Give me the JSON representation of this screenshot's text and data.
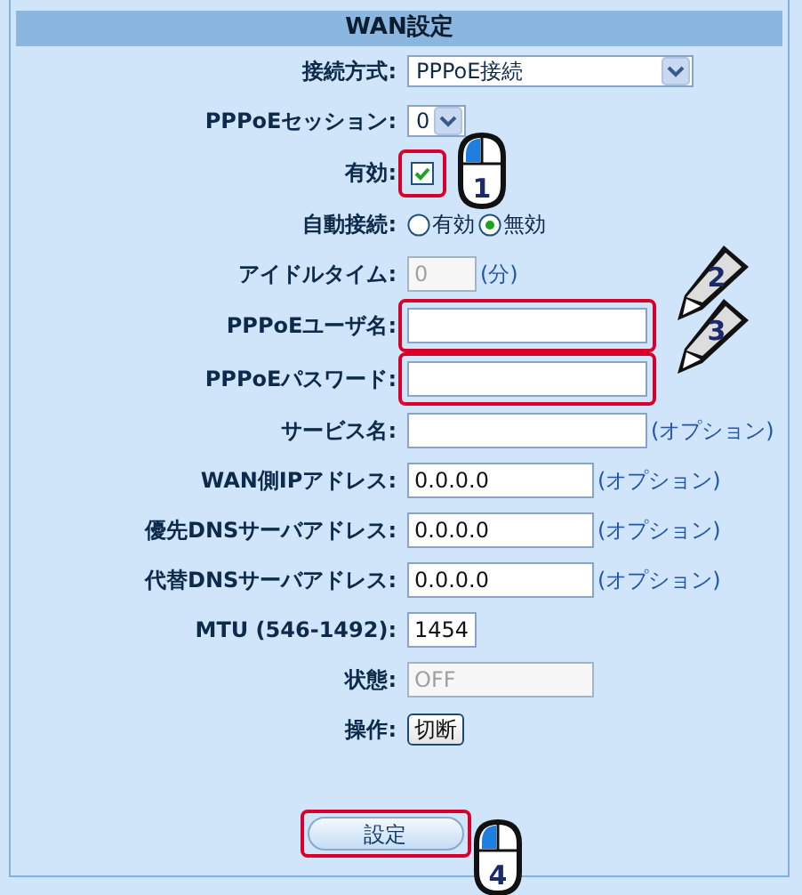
{
  "title": "WAN設定",
  "rows": [
    {
      "kind": "select",
      "label": "接続方式:",
      "value": "PPPoE接続"
    },
    {
      "kind": "select",
      "label": "PPPoEセッション:",
      "value": "0"
    },
    {
      "kind": "checkbox",
      "label": "有効:",
      "checked": true,
      "highlighted": true,
      "callout": {
        "kind": "mouse",
        "number": "1"
      }
    },
    {
      "kind": "radio",
      "label": "自動接続:",
      "options": [
        {
          "label": "有効",
          "selected": false
        },
        {
          "label": "無効",
          "selected": true
        }
      ]
    },
    {
      "kind": "input",
      "label": "アイドルタイム:",
      "value": "0",
      "disabled": true,
      "note": "(分)"
    },
    {
      "kind": "input",
      "label": "PPPoEユーザ名:",
      "value": "",
      "disabled": false,
      "highlighted": true,
      "callout": {
        "kind": "pencil",
        "number": "2"
      }
    },
    {
      "kind": "input",
      "label": "PPPoEパスワード:",
      "value": "",
      "disabled": false,
      "highlighted": true,
      "callout": {
        "kind": "pencil",
        "number": "3"
      }
    },
    {
      "kind": "input",
      "label": "サービス名:",
      "value": "",
      "disabled": false,
      "note": "(オプション)"
    },
    {
      "kind": "input",
      "label": "WAN側IPアドレス:",
      "value": "0.0.0.0",
      "disabled": false,
      "note": "(オプション)"
    },
    {
      "kind": "input",
      "label": "優先DNSサーバアドレス:",
      "value": "0.0.0.0",
      "disabled": false,
      "note": "(オプション)"
    },
    {
      "kind": "input",
      "label": "代替DNSサーバアドレス:",
      "value": "0.0.0.0",
      "disabled": false,
      "note": "(オプション)"
    },
    {
      "kind": "input",
      "label": "MTU (546-1492):",
      "value": "1454",
      "disabled": false
    },
    {
      "kind": "input",
      "label": "状態:",
      "value": "OFF",
      "disabled": true
    },
    {
      "kind": "button",
      "label": "操作:",
      "value": "切断"
    }
  ],
  "submit": {
    "label": "設定",
    "highlighted": true,
    "callout": {
      "kind": "mouse",
      "number": "4"
    }
  }
}
